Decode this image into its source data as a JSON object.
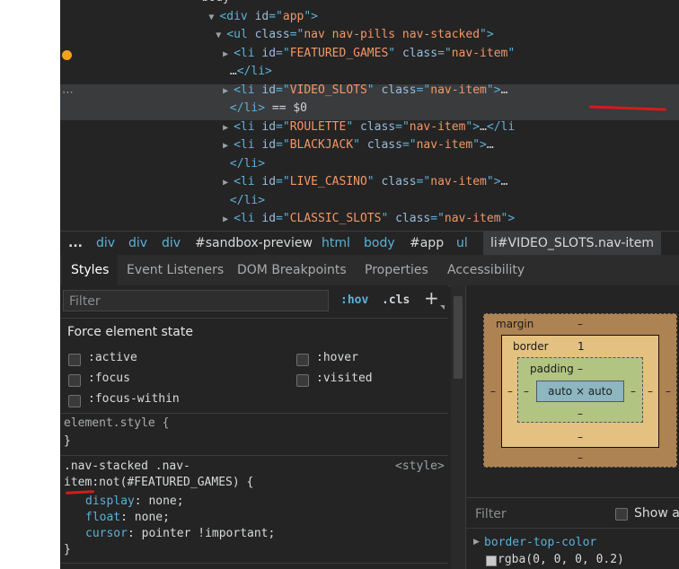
{
  "dom_tree": {
    "lines": [
      {
        "indent": 19,
        "triangle": "",
        "parts": [
          {
            "c": "txt",
            "t": "<body>"
          }
        ]
      },
      {
        "indent": 21,
        "triangle": "▼",
        "parts": [
          {
            "c": "tag",
            "t": "<div "
          },
          {
            "c": "attr",
            "t": "id"
          },
          {
            "c": "tag",
            "t": "=\""
          },
          {
            "c": "val",
            "t": "app"
          },
          {
            "c": "tag",
            "t": "\">"
          }
        ]
      },
      {
        "indent": 22,
        "triangle": "▼",
        "parts": [
          {
            "c": "tag",
            "t": "<ul "
          },
          {
            "c": "attr",
            "t": "class"
          },
          {
            "c": "tag",
            "t": "=\""
          },
          {
            "c": "val",
            "t": "nav nav-pills nav-stacked"
          },
          {
            "c": "tag",
            "t": "\">"
          }
        ]
      },
      {
        "indent": 23,
        "triangle": "▶",
        "parts": [
          {
            "c": "tag",
            "t": "<li "
          },
          {
            "c": "attr",
            "t": "id"
          },
          {
            "c": "tag",
            "t": "=\""
          },
          {
            "c": "val",
            "t": "FEATURED_GAMES"
          },
          {
            "c": "tag",
            "t": "\" "
          },
          {
            "c": "attr",
            "t": "class"
          },
          {
            "c": "tag",
            "t": "=\""
          },
          {
            "c": "val",
            "t": "nav-item"
          },
          {
            "c": "tag",
            "t": "\""
          }
        ]
      },
      {
        "indent": 24,
        "triangle": "",
        "parts": [
          {
            "c": "txt",
            "t": "…"
          },
          {
            "c": "tag",
            "t": "</li>"
          }
        ]
      },
      {
        "indent": 23,
        "triangle": "▶",
        "parts": [
          {
            "c": "tag",
            "t": "<li "
          },
          {
            "c": "attr",
            "t": "id"
          },
          {
            "c": "tag",
            "t": "=\""
          },
          {
            "c": "val",
            "t": "VIDEO_SLOTS"
          },
          {
            "c": "tag",
            "t": "\" "
          },
          {
            "c": "attr",
            "t": "class"
          },
          {
            "c": "tag",
            "t": "=\""
          },
          {
            "c": "val",
            "t": "nav-item"
          },
          {
            "c": "tag",
            "t": "\">"
          },
          {
            "c": "txt",
            "t": "…"
          }
        ]
      },
      {
        "indent": 24,
        "triangle": "",
        "parts": [
          {
            "c": "tag",
            "t": "</li>"
          },
          {
            "c": "txt",
            "t": " == $0"
          }
        ]
      },
      {
        "indent": 23,
        "triangle": "▶",
        "parts": [
          {
            "c": "tag",
            "t": "<li "
          },
          {
            "c": "attr",
            "t": "id"
          },
          {
            "c": "tag",
            "t": "=\""
          },
          {
            "c": "val",
            "t": "ROULETTE"
          },
          {
            "c": "tag",
            "t": "\" "
          },
          {
            "c": "attr",
            "t": "class"
          },
          {
            "c": "tag",
            "t": "=\""
          },
          {
            "c": "val",
            "t": "nav-item"
          },
          {
            "c": "tag",
            "t": "\">"
          },
          {
            "c": "txt",
            "t": "…"
          },
          {
            "c": "tag",
            "t": "</li"
          }
        ]
      },
      {
        "indent": 23,
        "triangle": "▶",
        "parts": [
          {
            "c": "tag",
            "t": "<li "
          },
          {
            "c": "attr",
            "t": "id"
          },
          {
            "c": "tag",
            "t": "=\""
          },
          {
            "c": "val",
            "t": "BLACKJACK"
          },
          {
            "c": "tag",
            "t": "\" "
          },
          {
            "c": "attr",
            "t": "class"
          },
          {
            "c": "tag",
            "t": "=\""
          },
          {
            "c": "val",
            "t": "nav-item"
          },
          {
            "c": "tag",
            "t": "\">"
          },
          {
            "c": "txt",
            "t": "…"
          }
        ]
      },
      {
        "indent": 24,
        "triangle": "",
        "parts": [
          {
            "c": "tag",
            "t": "</li>"
          }
        ]
      },
      {
        "indent": 23,
        "triangle": "▶",
        "parts": [
          {
            "c": "tag",
            "t": "<li "
          },
          {
            "c": "attr",
            "t": "id"
          },
          {
            "c": "tag",
            "t": "=\""
          },
          {
            "c": "val",
            "t": "LIVE_CASINO"
          },
          {
            "c": "tag",
            "t": "\" "
          },
          {
            "c": "attr",
            "t": "class"
          },
          {
            "c": "tag",
            "t": "=\""
          },
          {
            "c": "val",
            "t": "nav-item"
          },
          {
            "c": "tag",
            "t": "\">"
          },
          {
            "c": "txt",
            "t": "…"
          }
        ]
      },
      {
        "indent": 24,
        "triangle": "",
        "parts": [
          {
            "c": "tag",
            "t": "</li>"
          }
        ]
      },
      {
        "indent": 23,
        "triangle": "▶",
        "parts": [
          {
            "c": "tag",
            "t": "<li "
          },
          {
            "c": "attr",
            "t": "id"
          },
          {
            "c": "tag",
            "t": "=\""
          },
          {
            "c": "val",
            "t": "CLASSIC_SLOTS"
          },
          {
            "c": "tag",
            "t": "\" "
          },
          {
            "c": "attr",
            "t": "class"
          },
          {
            "c": "tag",
            "t": "=\""
          },
          {
            "c": "val",
            "t": "nav-item"
          },
          {
            "c": "tag",
            "t": "\">"
          }
        ]
      }
    ]
  },
  "breadcrumb": {
    "items": [
      "...",
      "div",
      "div",
      "div",
      "#sandbox-preview",
      "html",
      "body",
      "#app",
      "ul",
      "li#VIDEO_SLOTS.nav-item"
    ]
  },
  "tabs": [
    "Styles",
    "Event Listeners",
    "DOM Breakpoints",
    "Properties",
    "Accessibility"
  ],
  "styles_pane": {
    "filter_placeholder": "Filter",
    "hov": ":hov",
    "cls": ".cls",
    "plus": "+",
    "force_title": "Force element state",
    "states": [
      ":active",
      ":hover",
      ":focus",
      ":visited",
      ":focus-within"
    ],
    "element_style": "element.style {",
    "close_brace": "}",
    "rule_selector_1": ".nav-stacked .nav-",
    "rule_selector_2a": "item",
    "rule_selector_2b": ":not(#FEATURED_GAMES) {",
    "rule_source": "<style>",
    "declarations": [
      {
        "prop": "display",
        "value": "none;"
      },
      {
        "prop": "float",
        "value": "none;"
      },
      {
        "prop": "cursor",
        "value": "pointer !important;"
      }
    ]
  },
  "computed_pane": {
    "margin_label": "margin",
    "border_label": "border",
    "padding_label": "padding",
    "dash": "–",
    "border_value": "1",
    "content": "auto × auto",
    "filter_placeholder": "Filter",
    "show_all": "Show all",
    "property": "border-top-color",
    "value": "rgba(0, 0, 0, 0.2)"
  },
  "colors": {
    "annotation_red": "#d61b1b",
    "breakpoint_orange": "#f3a21c"
  }
}
